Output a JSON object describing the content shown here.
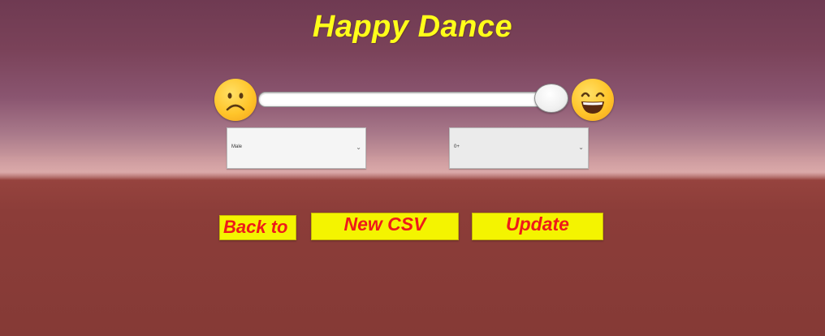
{
  "title": "Happy Dance",
  "mood_slider": {
    "value": 1.0,
    "min_icon": "frowning-face-icon",
    "max_icon": "grinning-face-icon"
  },
  "dropdowns": {
    "left": {
      "selected": "Male"
    },
    "right": {
      "selected": "0+"
    }
  },
  "buttons": {
    "back": "Back to",
    "new_csv": "New CSV",
    "update": "Update"
  },
  "colors": {
    "title": "#ffff1a",
    "button_bg": "#f4f400",
    "button_text": "#ee1a1a",
    "emoji": "#ffc52a"
  }
}
